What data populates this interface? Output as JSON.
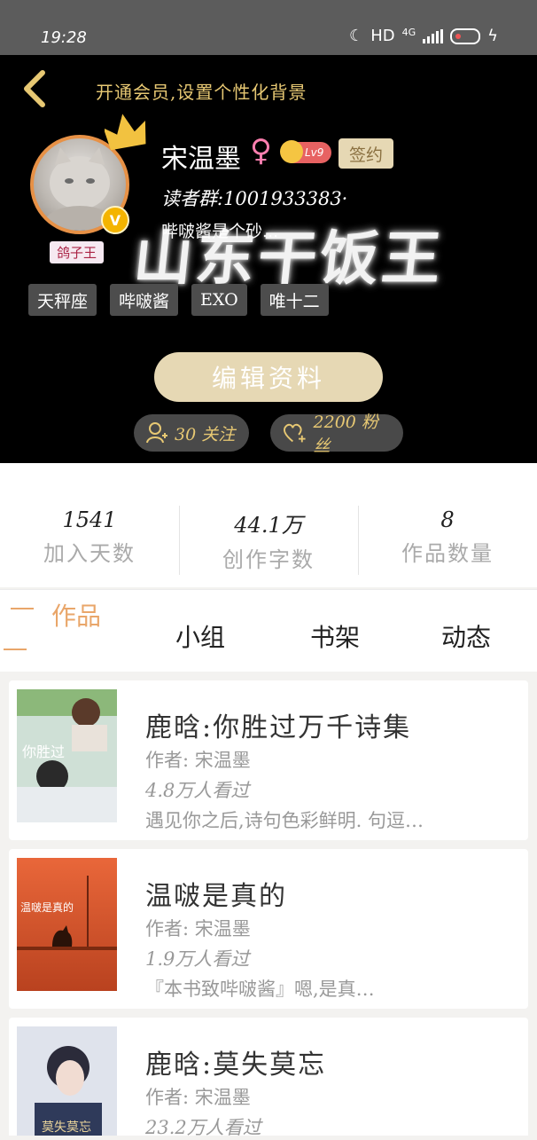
{
  "status_bar": {
    "time": "19:28",
    "network_label": "HD",
    "network_gen": "4G"
  },
  "header": {
    "vip_hint": "开通会员,设置个性化背景",
    "username": "宋温墨",
    "gender_symbol": "♀",
    "level": "Lv9",
    "signed_label": "签约",
    "reader_group": "读者群:1001933383·",
    "bio": "哔啵酱是个砂...",
    "watermark": "山东干饭王",
    "title_badge": "鸽子王",
    "verified_badge": "V",
    "tags": [
      "天秤座",
      "哔啵酱",
      "EXO",
      "唯十二"
    ],
    "edit_button": "编辑资料",
    "following": "30 关注",
    "fans": "2200 粉丝",
    "accent_color": "#e7c873"
  },
  "stats": [
    {
      "value": "1541",
      "label": "加入天数"
    },
    {
      "value": "44.1万",
      "label": "创作字数"
    },
    {
      "value": "8",
      "label": "作品数量"
    }
  ],
  "tabs": [
    {
      "label": "作品",
      "active": true
    },
    {
      "label": "小组",
      "active": false
    },
    {
      "label": "书架",
      "active": false
    },
    {
      "label": "动态",
      "active": false
    }
  ],
  "books": [
    {
      "title": "鹿晗:你胜过万千诗集",
      "author": "作者: 宋温墨",
      "views": "4.8万人看过",
      "desc": "遇见你之后,诗句色彩鲜明. 句逗…"
    },
    {
      "title": "温啵是真的",
      "author": "作者: 宋温墨",
      "views": "1.9万人看过",
      "desc": "『本书致哔啵酱』嗯,是真…"
    },
    {
      "title": "鹿晗:莫失莫忘",
      "author": "作者: 宋温墨",
      "views": "23.2万人看过",
      "desc": ""
    }
  ]
}
